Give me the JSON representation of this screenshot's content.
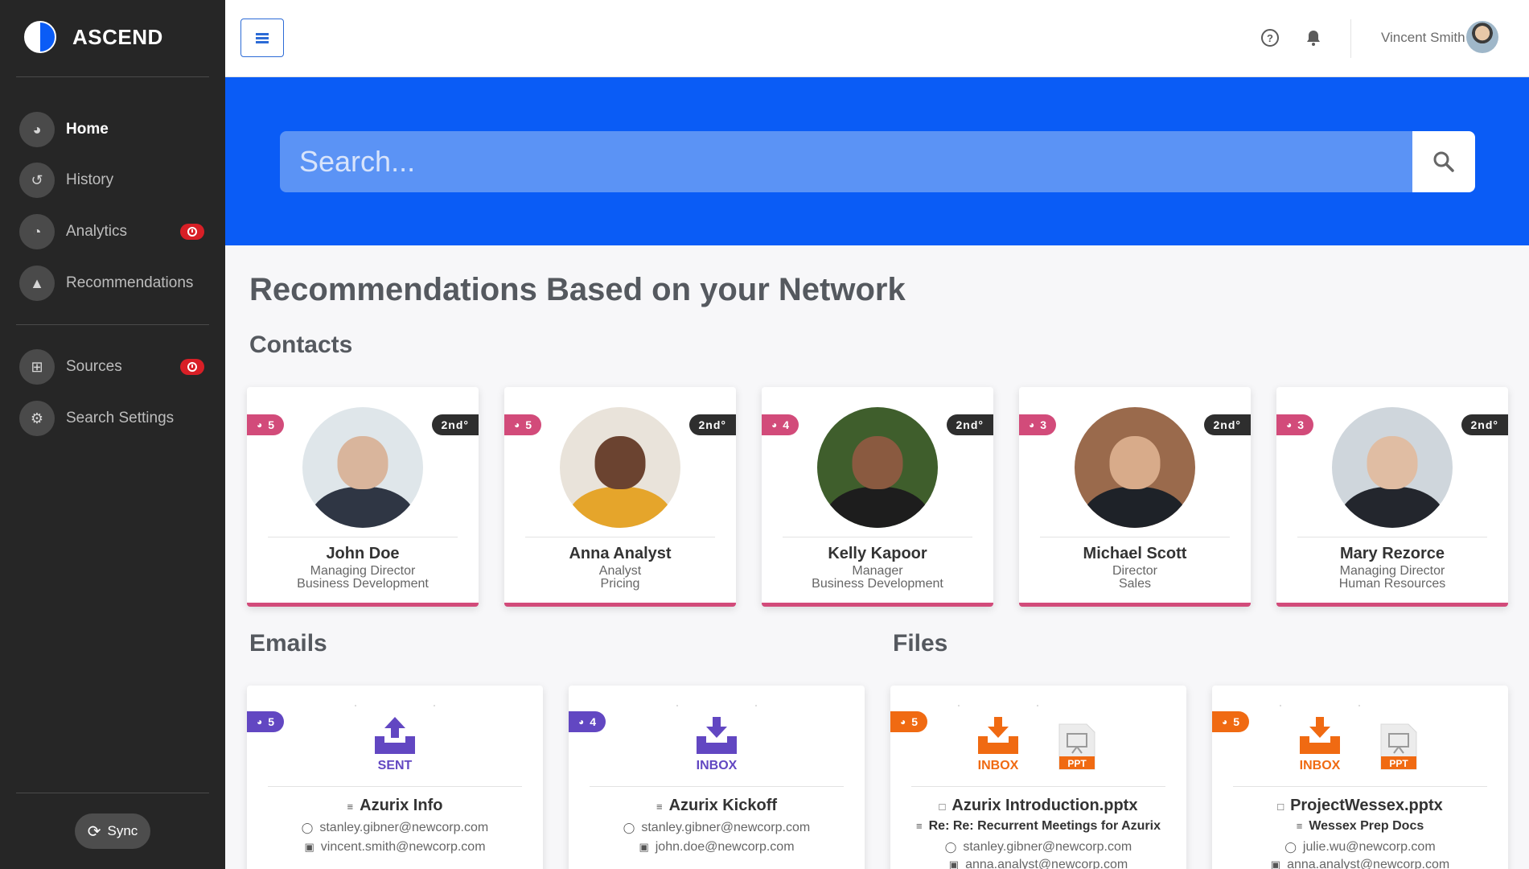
{
  "app": {
    "name": "ASCEND"
  },
  "sidebar": {
    "nav": [
      {
        "label": "Home",
        "icon": "dashboard-icon"
      },
      {
        "label": "History",
        "icon": "history-icon"
      },
      {
        "label": "Analytics",
        "icon": "pie-chart-icon"
      },
      {
        "label": "Recommendations",
        "icon": "thumbs-up-icon"
      }
    ],
    "nav2": [
      {
        "label": "Sources",
        "icon": "grid-icon"
      },
      {
        "label": "Search Settings",
        "icon": "cogs-icon"
      }
    ],
    "sync_label": "Sync"
  },
  "topbar": {
    "user_name": "Vincent Smith"
  },
  "search": {
    "placeholder": "Search..."
  },
  "page": {
    "title": "Recommendations Based on your Network",
    "contacts_title": "Contacts",
    "emails_title": "Emails",
    "files_title": "Files"
  },
  "contacts": [
    {
      "score": "5",
      "degree": "2nd°",
      "name": "John Doe",
      "title": "Managing Director",
      "dept": "Business Development"
    },
    {
      "score": "5",
      "degree": "2nd°",
      "name": "Anna Analyst",
      "title": "Analyst",
      "dept": "Pricing"
    },
    {
      "score": "4",
      "degree": "2nd°",
      "name": "Kelly Kapoor",
      "title": "Manager",
      "dept": "Business Development"
    },
    {
      "score": "3",
      "degree": "2nd°",
      "name": "Michael Scott",
      "title": "Director",
      "dept": "Sales"
    },
    {
      "score": "3",
      "degree": "2nd°",
      "name": "Mary Rezorce",
      "title": "Managing Director",
      "dept": "Human Resources"
    }
  ],
  "emails": [
    {
      "score": "5",
      "box_label": "SENT",
      "title": "Azurix Info",
      "line1": "stanley.gibner@newcorp.com",
      "line2": "vincent.smith@newcorp.com"
    },
    {
      "score": "4",
      "box_label": "INBOX",
      "title": "Azurix Kickoff",
      "line1": "stanley.gibner@newcorp.com",
      "line2": "john.doe@newcorp.com"
    }
  ],
  "files": [
    {
      "score": "5",
      "box_label": "INBOX",
      "file_type": "PPT",
      "title": "Azurix Introduction.pptx",
      "subject": "Re: Re: Recurrent Meetings for Azurix",
      "line1": "stanley.gibner@newcorp.com",
      "line2": "anna.analyst@newcorp.com"
    },
    {
      "score": "5",
      "box_label": "INBOX",
      "file_type": "PPT",
      "title": "ProjectWessex.pptx",
      "subject": "Wessex Prep Docs",
      "line1": "julie.wu@newcorp.com",
      "line2": "anna.analyst@newcorp.com"
    }
  ],
  "colors": {
    "sidebar_bg": "#262626",
    "hero_blue": "#0a5cf6",
    "contact_accent": "#d24b7a",
    "email_accent": "#6247c2",
    "file_accent": "#f06a12",
    "badge_red": "#d81f26"
  }
}
